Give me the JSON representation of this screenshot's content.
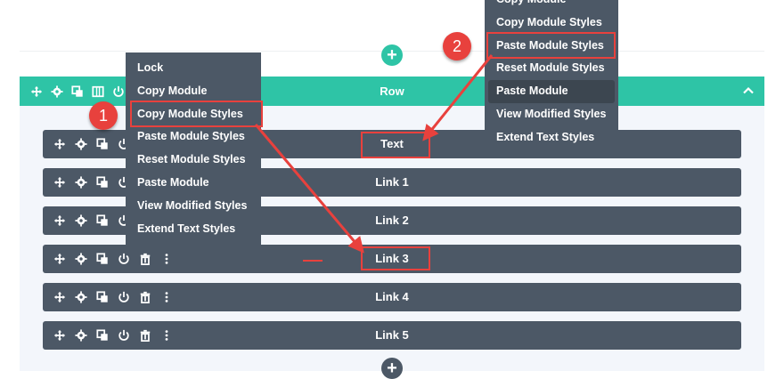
{
  "row": {
    "label": "Row"
  },
  "modules": [
    {
      "label": "Text"
    },
    {
      "label": "Link 1"
    },
    {
      "label": "Link 2"
    },
    {
      "label": "Link 3"
    },
    {
      "label": "Link 4"
    },
    {
      "label": "Link 5"
    }
  ],
  "menu_left": {
    "items": [
      "Lock",
      "Copy Module",
      "Copy Module Styles",
      "Paste Module Styles",
      "Reset Module Styles",
      "Paste Module",
      "View Modified Styles",
      "Extend Text Styles"
    ]
  },
  "menu_right": {
    "items": [
      "Copy Module",
      "Copy Module Styles",
      "Paste Module Styles",
      "Reset Module Styles",
      "Paste Module",
      "View Modified Styles",
      "Extend Text Styles"
    ],
    "active_item": "Paste Module"
  },
  "callouts": {
    "one": "1",
    "two": "2"
  },
  "icons": {
    "row_toolbar": [
      "move-icon",
      "gear-icon",
      "duplicate-icon",
      "columns-icon",
      "power-icon"
    ],
    "module_toolbar": [
      "move-icon",
      "gear-icon",
      "duplicate-icon",
      "power-icon",
      "trash-icon",
      "more-icon"
    ],
    "collapse": "chevron-up-icon",
    "add": "plus-icon"
  },
  "colors": {
    "row_bar": "#2ec4a6",
    "module_bar": "#4c5866",
    "menu_bg": "#4c5866",
    "annotation_red": "#e8413d",
    "add_button_teal": "#2ec4a6",
    "add_button_dark": "#4c5866",
    "row_background": "#f3f6fb"
  }
}
